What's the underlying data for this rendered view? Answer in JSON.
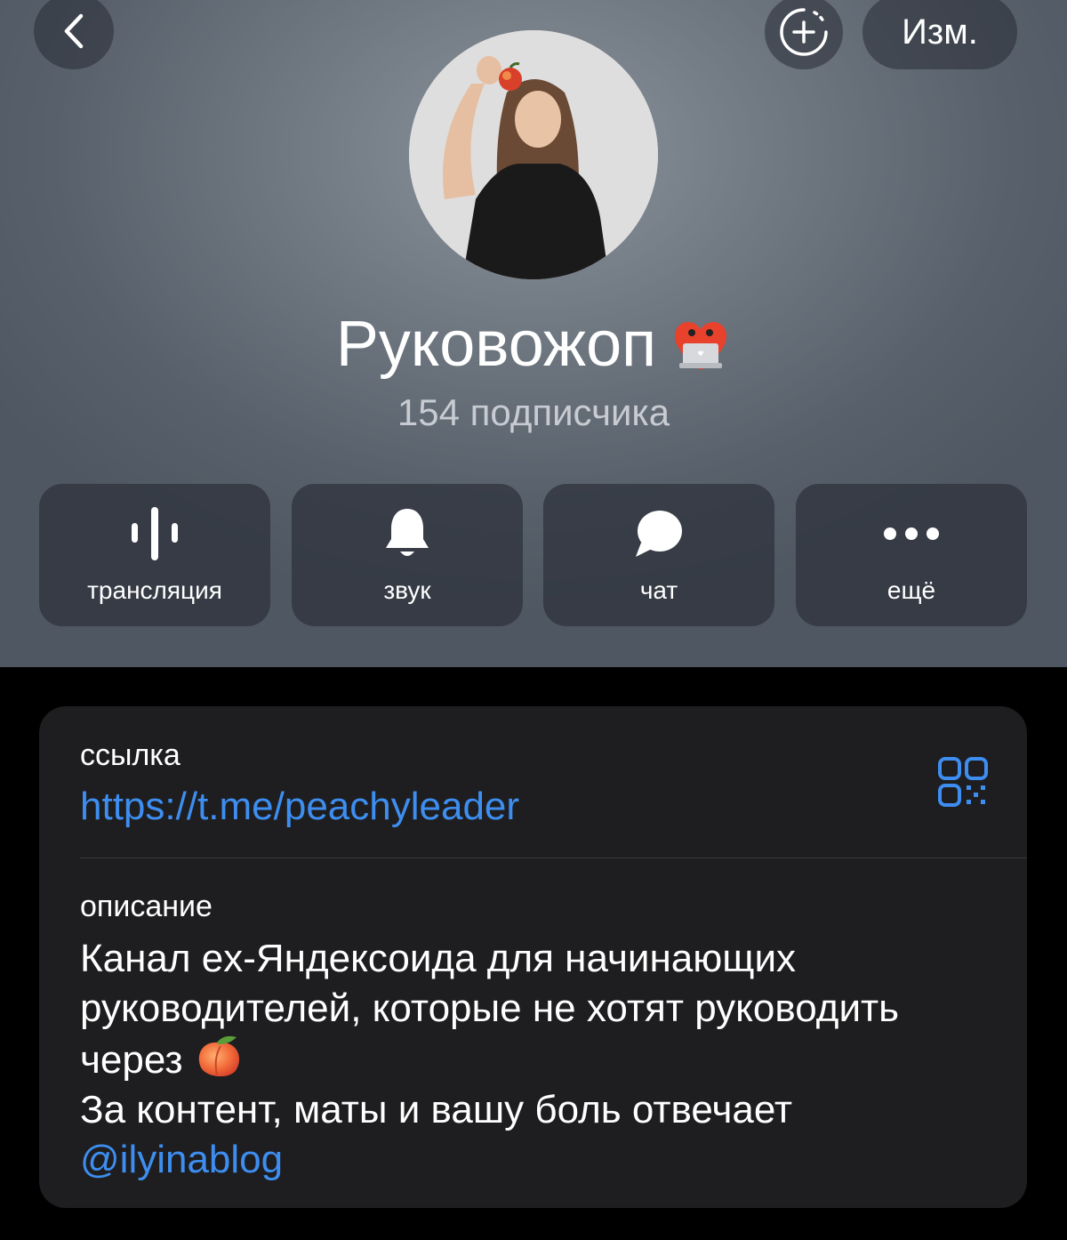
{
  "nav": {
    "edit_label": "Изм."
  },
  "channel": {
    "name": "Руковожоп",
    "subscribers": "154 подписчика"
  },
  "actions": [
    {
      "label": "трансляция",
      "icon": "live-stream-icon"
    },
    {
      "label": "звук",
      "icon": "bell-icon"
    },
    {
      "label": "чат",
      "icon": "chat-bubble-icon"
    },
    {
      "label": "ещё",
      "icon": "more-dots-icon"
    }
  ],
  "info": {
    "link_label": "ссылка",
    "link_value": "https://t.me/peachyleader",
    "description_label": "описание",
    "description_line1": "Канал ex-Яндексоида для начинающих",
    "description_line2": "руководителей, которые не хотят руководить",
    "description_line3": "через",
    "description_line4": "За контент, маты и вашу боль отвечает",
    "mention": "@ilyinablog"
  },
  "colors": {
    "accent": "#3d8ef0",
    "card_bg": "#1e1e20",
    "header_bg": "#6f7781"
  }
}
